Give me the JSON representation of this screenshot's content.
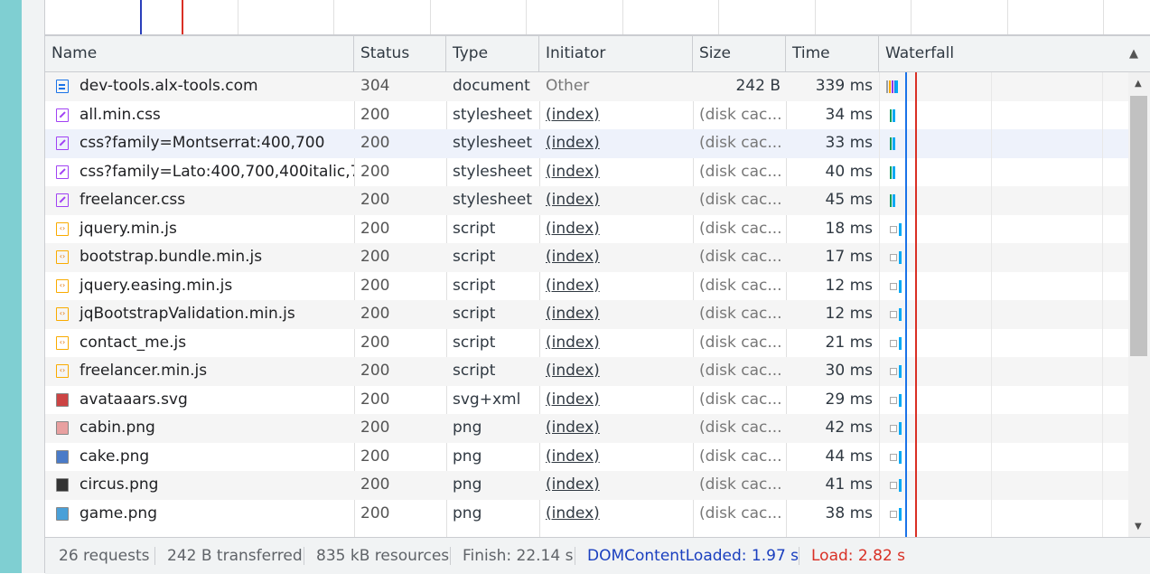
{
  "columns": {
    "name": "Name",
    "status": "Status",
    "type": "Type",
    "initiator": "Initiator",
    "size": "Size",
    "time": "Time",
    "waterfall": "Waterfall",
    "sort_arrow": "▲"
  },
  "colors": {
    "dom_content_loaded": "#1a73e8",
    "load": "#d93025",
    "selected_row": "#eef2fb"
  },
  "rows": [
    {
      "icon": "document-icon",
      "name": "dev-tools.alx-tools.com",
      "status": "304",
      "type": "document",
      "initiator": "Other",
      "size": "242 B",
      "time": "339 ms"
    },
    {
      "icon": "stylesheet-icon",
      "name": "all.min.css",
      "status": "200",
      "type": "stylesheet",
      "initiator": "(index)",
      "size": "(disk cac...",
      "time": "34 ms"
    },
    {
      "icon": "stylesheet-icon",
      "name": "css?family=Montserrat:400,700",
      "status": "200",
      "type": "stylesheet",
      "initiator": "(index)",
      "size": "(disk cac...",
      "time": "33 ms"
    },
    {
      "icon": "stylesheet-icon",
      "name": "css?family=Lato:400,700,400italic,7...",
      "status": "200",
      "type": "stylesheet",
      "initiator": "(index)",
      "size": "(disk cac...",
      "time": "40 ms"
    },
    {
      "icon": "stylesheet-icon",
      "name": "freelancer.css",
      "status": "200",
      "type": "stylesheet",
      "initiator": "(index)",
      "size": "(disk cac...",
      "time": "45 ms"
    },
    {
      "icon": "script-icon",
      "name": "jquery.min.js",
      "status": "200",
      "type": "script",
      "initiator": "(index)",
      "size": "(disk cac...",
      "time": "18 ms"
    },
    {
      "icon": "script-icon",
      "name": "bootstrap.bundle.min.js",
      "status": "200",
      "type": "script",
      "initiator": "(index)",
      "size": "(disk cac...",
      "time": "17 ms"
    },
    {
      "icon": "script-icon",
      "name": "jquery.easing.min.js",
      "status": "200",
      "type": "script",
      "initiator": "(index)",
      "size": "(disk cac...",
      "time": "12 ms"
    },
    {
      "icon": "script-icon",
      "name": "jqBootstrapValidation.min.js",
      "status": "200",
      "type": "script",
      "initiator": "(index)",
      "size": "(disk cac...",
      "time": "12 ms"
    },
    {
      "icon": "script-icon",
      "name": "contact_me.js",
      "status": "200",
      "type": "script",
      "initiator": "(index)",
      "size": "(disk cac...",
      "time": "21 ms"
    },
    {
      "icon": "script-icon",
      "name": "freelancer.min.js",
      "status": "200",
      "type": "script",
      "initiator": "(index)",
      "size": "(disk cac...",
      "time": "30 ms"
    },
    {
      "icon": "image-icon",
      "name": "avataaars.svg",
      "status": "200",
      "type": "svg+xml",
      "initiator": "(index)",
      "size": "(disk cac...",
      "time": "29 ms"
    },
    {
      "icon": "image-icon",
      "name": "cabin.png",
      "status": "200",
      "type": "png",
      "initiator": "(index)",
      "size": "(disk cac...",
      "time": "42 ms"
    },
    {
      "icon": "image-icon",
      "name": "cake.png",
      "status": "200",
      "type": "png",
      "initiator": "(index)",
      "size": "(disk cac...",
      "time": "44 ms"
    },
    {
      "icon": "image-icon",
      "name": "circus.png",
      "status": "200",
      "type": "png",
      "initiator": "(index)",
      "size": "(disk cac...",
      "time": "41 ms"
    },
    {
      "icon": "image-icon",
      "name": "game.png",
      "status": "200",
      "type": "png",
      "initiator": "(index)",
      "size": "(disk cac...",
      "time": "38 ms"
    }
  ],
  "status_bar": {
    "requests": "26 requests",
    "transferred": "242 B transferred",
    "resources": "835 kB resources",
    "finish": "Finish: 22.14 s",
    "dom_content_loaded": "DOMContentLoaded: 1.97 s",
    "load": "Load: 2.82 s"
  }
}
